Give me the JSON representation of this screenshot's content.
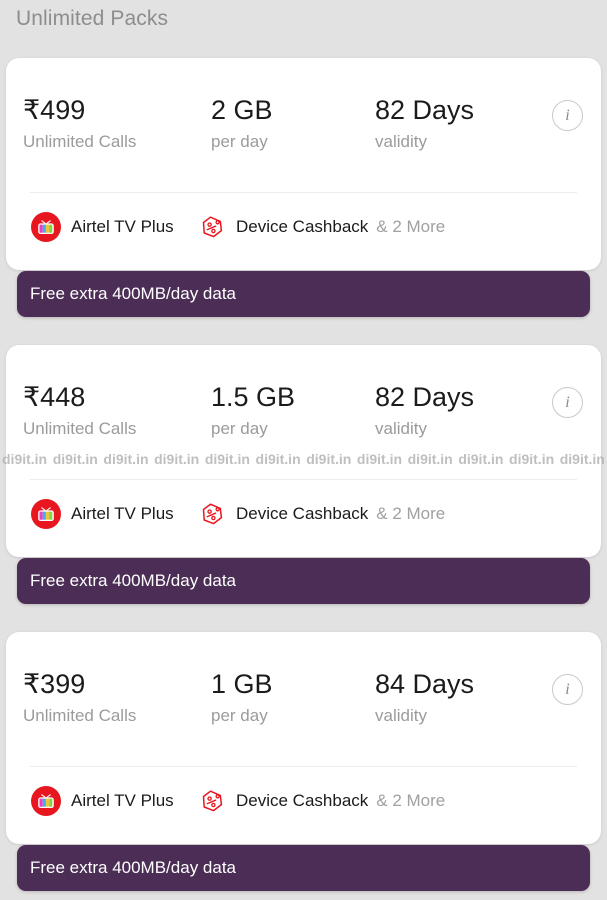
{
  "header": {
    "title": "Unlimited Packs"
  },
  "colors": {
    "background": "#e2e2e2",
    "card": "#ffffff",
    "promo_purple": "#4b2d55",
    "brand_red": "#e40000",
    "muted_text": "#9b9b9b",
    "primary_text": "#1b1b1b"
  },
  "icons": {
    "info": "i",
    "airtel_tv": "airtel-tv-icon",
    "cashback_tag": "cashback-tag-icon"
  },
  "packs": [
    {
      "price": "₹499",
      "price_symbol": "₹",
      "price_amount": "499",
      "price_sub": "Unlimited Calls",
      "data": "2 GB",
      "data_sub": "per day",
      "validity": "82 Days",
      "validity_sub": "validity",
      "info_label": "i",
      "benefits": [
        {
          "label": "Airtel TV Plus",
          "icon": "airtel-tv-icon"
        },
        {
          "label": "Device Cashback",
          "icon": "cashback-tag-icon"
        }
      ],
      "more_label": "& 2 More",
      "promo": "Free extra 400MB/day data"
    },
    {
      "price": "₹448",
      "price_symbol": "₹",
      "price_amount": "448",
      "price_sub": "Unlimited Calls",
      "data": "1.5 GB",
      "data_sub": "per day",
      "validity": "82 Days",
      "validity_sub": "validity",
      "info_label": "i",
      "benefits": [
        {
          "label": "Airtel TV Plus",
          "icon": "airtel-tv-icon"
        },
        {
          "label": "Device Cashback",
          "icon": "cashback-tag-icon"
        }
      ],
      "more_label": "& 2 More",
      "promo": "Free extra 400MB/day data"
    },
    {
      "price": "₹399",
      "price_symbol": "₹",
      "price_amount": "399",
      "price_sub": "Unlimited Calls",
      "data": "1 GB",
      "data_sub": "per day",
      "validity": "84 Days",
      "validity_sub": "validity",
      "info_label": "i",
      "benefits": [
        {
          "label": "Airtel TV Plus",
          "icon": "airtel-tv-icon"
        },
        {
          "label": "Device Cashback",
          "icon": "cashback-tag-icon"
        }
      ],
      "more_label": "& 2 More",
      "promo": "Free extra 400MB/day data"
    }
  ],
  "watermark": {
    "text": "di9it.in",
    "repeat": 12
  }
}
